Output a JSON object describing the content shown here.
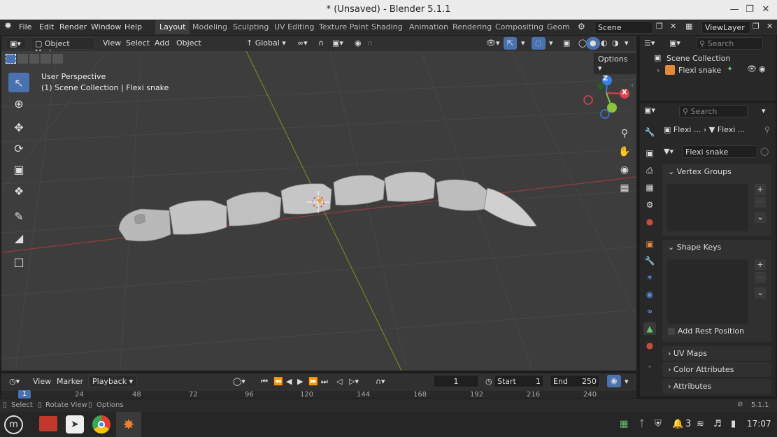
{
  "window": {
    "title": "* (Unsaved) - Blender 5.1.1"
  },
  "menu": [
    "File",
    "Edit",
    "Render",
    "Window",
    "Help"
  ],
  "workspaces": [
    "Layout",
    "Modeling",
    "Sculpting",
    "UV Editing",
    "Texture Paint",
    "Shading",
    "Animation",
    "Rendering",
    "Compositing",
    "Geom"
  ],
  "scene": {
    "name": "Scene",
    "view_layer": "ViewLayer"
  },
  "viewport_header": {
    "mode": "Object Mode",
    "view": "View",
    "select": "Select",
    "add": "Add",
    "object": "Object",
    "orientation": "Global",
    "search_placeholder": "Search",
    "options": "Options"
  },
  "viewport": {
    "perspective": "User Perspective",
    "context": "(1) Scene Collection | Flexi snake"
  },
  "gizmo": {
    "z": "Z",
    "x": "X"
  },
  "outliner": {
    "collection": "Scene Collection",
    "object": "Flexi snake"
  },
  "properties": {
    "search_placeholder": "Search",
    "breadcrumb_obj": "Flexi ...",
    "breadcrumb_data": "Flexi ...",
    "mesh_name": "Flexi snake",
    "panels": {
      "vertex_groups": "Vertex Groups",
      "shape_keys": "Shape Keys",
      "add_rest_position": "Add Rest Position",
      "uv_maps": "UV Maps",
      "color_attributes": "Color Attributes",
      "attributes": "Attributes"
    }
  },
  "timeline": {
    "view": "View",
    "marker": "Marker",
    "playback": "Playback",
    "current_frame": "1",
    "start_label": "Start",
    "start": "1",
    "end_label": "End",
    "end": "250",
    "ruler": [
      "1",
      "24",
      "48",
      "72",
      "96",
      "120",
      "144",
      "168",
      "192",
      "216",
      "240"
    ]
  },
  "status": {
    "select": "Select",
    "rotate": "Rotate View",
    "options": "Options",
    "version": "5.1.1"
  },
  "taskbar": {
    "clock": "17:07",
    "notif": "3"
  },
  "colors": {
    "accent": "#4a72b0",
    "viewport_bg": "#3d3d3d",
    "x_axis": "#e0404f",
    "y_axis": "#8ac43a",
    "z_axis": "#3a7fe6"
  }
}
